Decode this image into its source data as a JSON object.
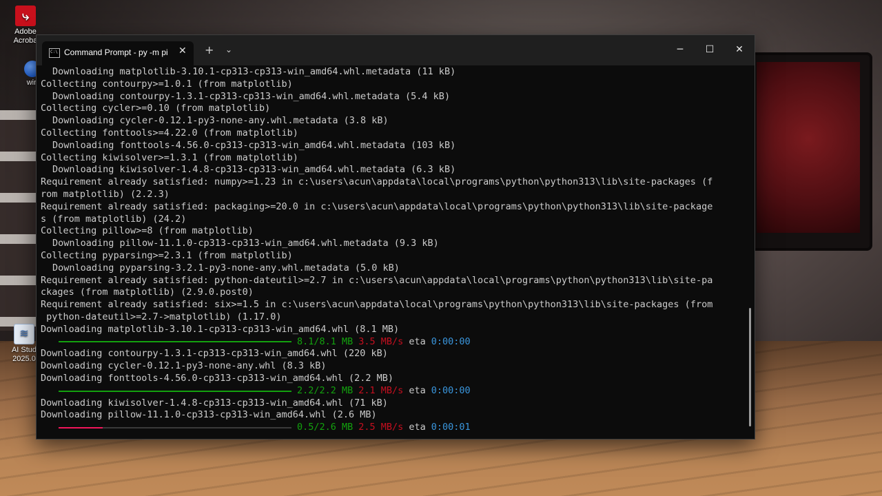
{
  "desktop": {
    "icons": [
      {
        "label": "Adobe Acroba",
        "icon": "pdf-icon"
      },
      {
        "label": "win",
        "icon": "app-icon"
      },
      {
        "label": "AI Stud 2025.0",
        "icon": "document-icon"
      }
    ]
  },
  "window": {
    "tab_title": "Command Prompt - py  -m pi",
    "tab_icon_text": "C:\\",
    "controls": {
      "minimize": "─",
      "maximize": "☐",
      "close": "✕",
      "new_tab": "+",
      "dropdown": "⌄",
      "tab_close": "✕"
    }
  },
  "colors": {
    "complete_bar": "#13a10e",
    "active_bar": "#f2165a",
    "size_text": "#13a10e",
    "speed_text": "#c50f1f",
    "eta_text": "#3a96dd"
  },
  "console": {
    "l1": "Downloading matplotlib-3.10.1-cp313-cp313-win_amd64.whl.metadata (11 kB)",
    "l2": "Collecting contourpy>=1.0.1 (from matplotlib)",
    "l3": "Downloading contourpy-1.3.1-cp313-cp313-win_amd64.whl.metadata (5.4 kB)",
    "l4": "Collecting cycler>=0.10 (from matplotlib)",
    "l5": "Downloading cycler-0.12.1-py3-none-any.whl.metadata (3.8 kB)",
    "l6": "Collecting fonttools>=4.22.0 (from matplotlib)",
    "l7": "Downloading fonttools-4.56.0-cp313-cp313-win_amd64.whl.metadata (103 kB)",
    "l8": "Collecting kiwisolver>=1.3.1 (from matplotlib)",
    "l9": "Downloading kiwisolver-1.4.8-cp313-cp313-win_amd64.whl.metadata (6.3 kB)",
    "l10": "Requirement already satisfied: numpy>=1.23 in c:\\users\\acun\\appdata\\local\\programs\\python\\python313\\lib\\site-packages (f",
    "l11": "rom matplotlib) (2.2.3)",
    "l12": "Requirement already satisfied: packaging>=20.0 in c:\\users\\acun\\appdata\\local\\programs\\python\\python313\\lib\\site-package",
    "l13": "s (from matplotlib) (24.2)",
    "l14": "Collecting pillow>=8 (from matplotlib)",
    "l15": "Downloading pillow-11.1.0-cp313-cp313-win_amd64.whl.metadata (9.3 kB)",
    "l16": "Collecting pyparsing>=2.3.1 (from matplotlib)",
    "l17": "Downloading pyparsing-3.2.1-py3-none-any.whl.metadata (5.0 kB)",
    "l18": "Requirement already satisfied: python-dateutil>=2.7 in c:\\users\\acun\\appdata\\local\\programs\\python\\python313\\lib\\site-pa",
    "l19": "ckages (from matplotlib) (2.9.0.post0)",
    "l20": "Requirement already satisfied: six>=1.5 in c:\\users\\acun\\appdata\\local\\programs\\python\\python313\\lib\\site-packages (from",
    "l21": " python-dateutil>=2.7->matplotlib) (1.17.0)",
    "l22": "Downloading matplotlib-3.10.1-cp313-cp313-win_amd64.whl (8.1 MB)",
    "p1": {
      "size": "8.1/8.1 MB",
      "speed": "3.5 MB/s",
      "eta_label": "eta",
      "eta": "0:00:00",
      "fraction": 1.0
    },
    "l23": "Downloading contourpy-1.3.1-cp313-cp313-win_amd64.whl (220 kB)",
    "l24": "Downloading cycler-0.12.1-py3-none-any.whl (8.3 kB)",
    "l25": "Downloading fonttools-4.56.0-cp313-cp313-win_amd64.whl (2.2 MB)",
    "p2": {
      "size": "2.2/2.2 MB",
      "speed": "2.1 MB/s",
      "eta_label": "eta",
      "eta": "0:00:00",
      "fraction": 1.0
    },
    "l26": "Downloading kiwisolver-1.4.8-cp313-cp313-win_amd64.whl (71 kB)",
    "l27": "Downloading pillow-11.1.0-cp313-cp313-win_amd64.whl (2.6 MB)",
    "p3": {
      "size": "0.5/2.6 MB",
      "speed": "2.5 MB/s",
      "eta_label": "eta",
      "eta": "0:00:01",
      "fraction": 0.19
    }
  }
}
